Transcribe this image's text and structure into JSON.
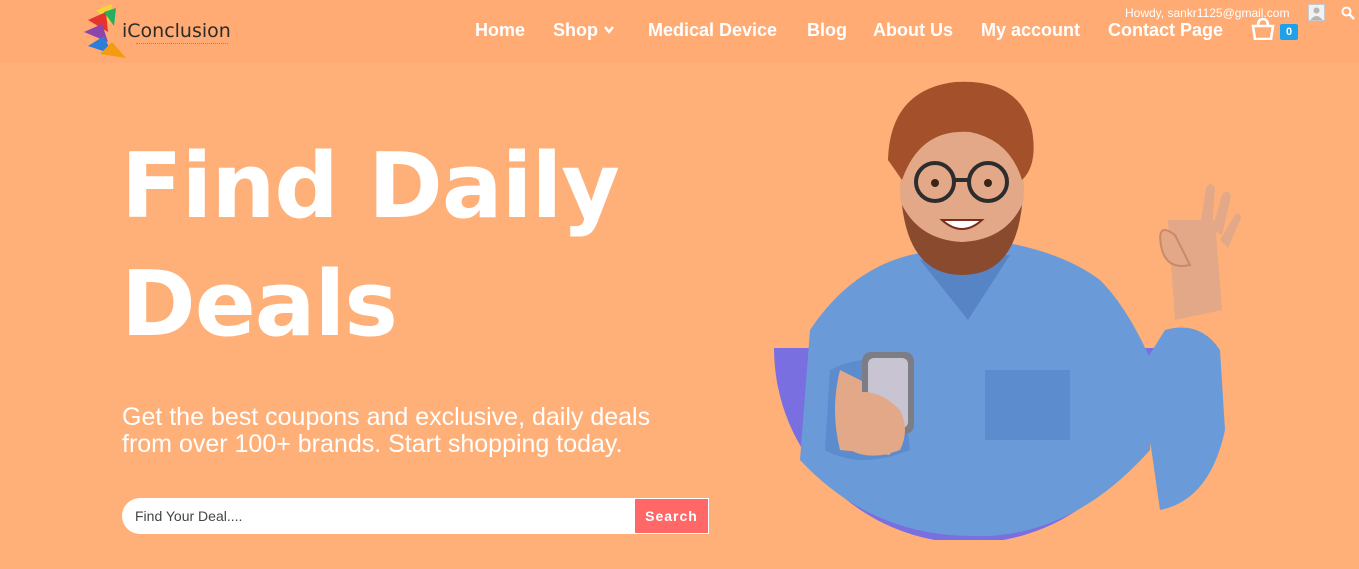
{
  "header": {
    "logo_text": "iConclusion",
    "nav": [
      {
        "label": "Home"
      },
      {
        "label": "Shop"
      },
      {
        "label": "Medical Device"
      },
      {
        "label": "Blog"
      },
      {
        "label": "About Us"
      },
      {
        "label": "My account"
      },
      {
        "label": "Contact Page"
      }
    ],
    "howdy": "Howdy, sankr1125@gmail.com",
    "cart_count": "0",
    "icons": {
      "shop_dropdown": "chevron-down-icon",
      "cart": "shopping-bag-icon",
      "search": "search-icon",
      "avatar": "user-avatar"
    }
  },
  "hero": {
    "title_line1": "Find Daily",
    "title_line2": "Deals",
    "subtitle_line1": "Get the best coupons and exclusive, daily deals",
    "subtitle_line2": "from over 100+ brands. Start shopping today.",
    "search_placeholder": "Find Your Deal....",
    "search_button": "Search"
  },
  "colors": {
    "background": "#ffb079",
    "header": "#ffab73",
    "search_button": "#ff6867",
    "badge": "#1ea1e8",
    "accent_purple": "#7a6fe0"
  }
}
